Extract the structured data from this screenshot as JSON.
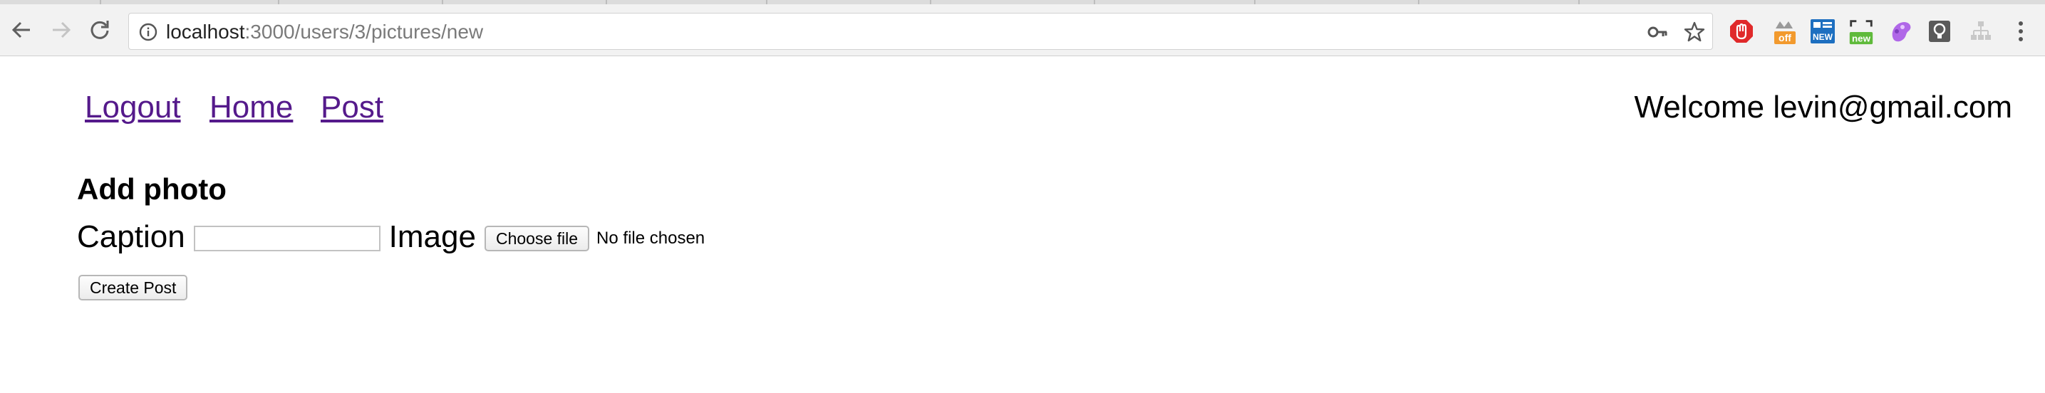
{
  "browser": {
    "url_host": "localhost",
    "url_path": ":3000/users/3/pictures/new",
    "extensions": [
      {
        "name": "adblock-extension-icon",
        "badge": ""
      },
      {
        "name": "tampermonkey-extension-icon",
        "badge": "off"
      },
      {
        "name": "news-extension-icon",
        "badge": "NEW"
      },
      {
        "name": "screenshot-extension-icon",
        "badge": "new"
      },
      {
        "name": "paint-extension-icon",
        "badge": ""
      },
      {
        "name": "keep-extension-icon",
        "badge": ""
      },
      {
        "name": "sitemap-extension-icon",
        "badge": ""
      }
    ]
  },
  "nav": {
    "logout": "Logout",
    "home": "Home",
    "post": "Post",
    "welcome": "Welcome levin@gmail.com"
  },
  "form": {
    "heading": "Add photo",
    "caption_label": "Caption",
    "caption_value": "",
    "image_label": "Image",
    "choose_file": "Choose file",
    "file_status": "No file chosen",
    "submit": "Create Post"
  },
  "colors": {
    "link_visited": "#551a8b",
    "adblock_red": "#e0292a",
    "badge_orange": "#f29a2e",
    "badge_blue": "#1d6fc0",
    "badge_green": "#5fba3b"
  }
}
